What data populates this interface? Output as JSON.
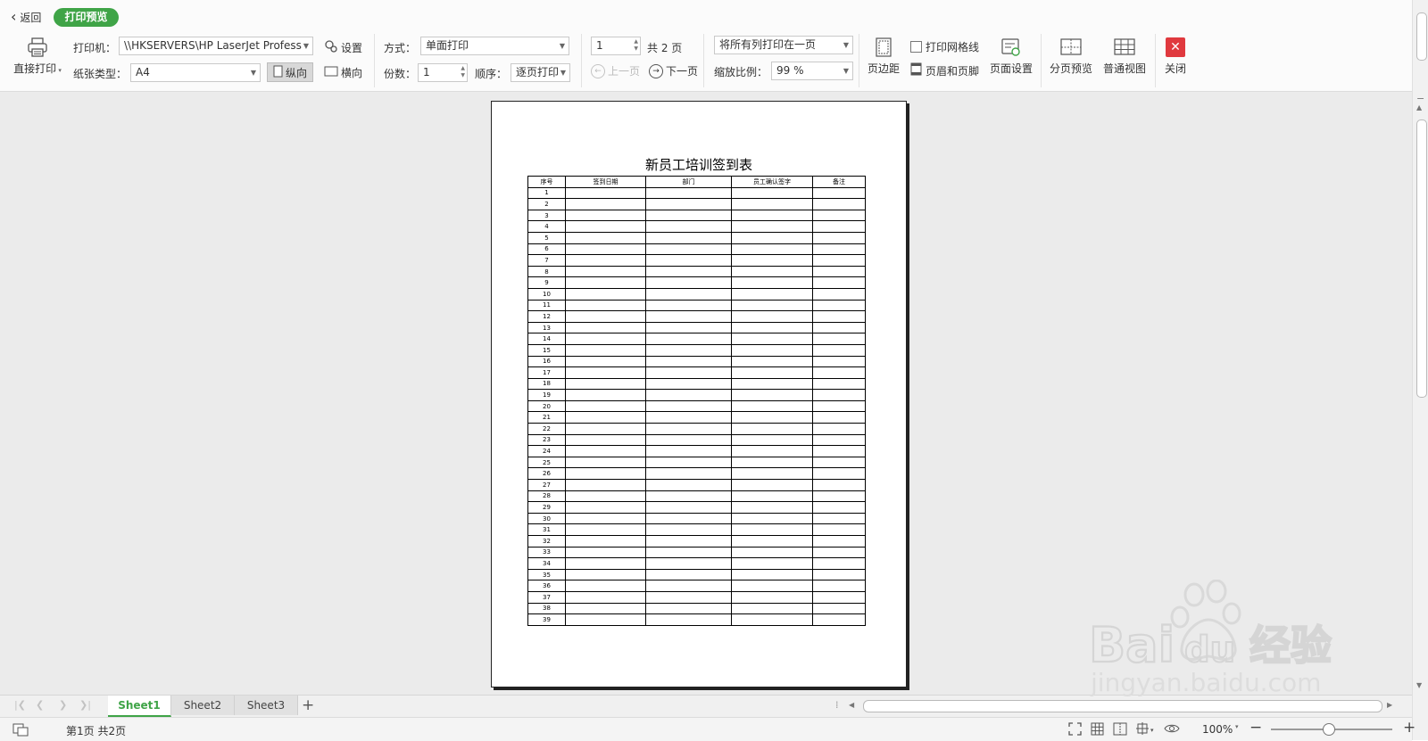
{
  "toolbar": {
    "back_label": "返回",
    "mode_badge": "打印预览",
    "direct_print_label": "直接打印",
    "printer_label": "打印机：",
    "printer_value": "\\\\HKSERVERS\\HP LaserJet Profess",
    "settings_label": "设置",
    "paper_type_label": "纸张类型：",
    "paper_type_value": "A4",
    "portrait_label": "纵向",
    "landscape_label": "横向",
    "method_label": "方式：",
    "method_value": "单面打印",
    "copies_label": "份数：",
    "copies_value": "1",
    "order_label": "顺序：",
    "order_value": "逐页打印",
    "page_value": "1",
    "total_pages": "共 2 页",
    "prev_page_label": "上一页",
    "next_page_label": "下一页",
    "fit_value": "将所有列打印在一页",
    "zoom_label": "缩放比例：",
    "zoom_value": "99 %",
    "margins_label": "页边距",
    "print_gridlines_label": "打印网格线",
    "header_footer_label": "页眉和页脚",
    "page_setup_label": "页面设置",
    "page_break_preview_label": "分页预览",
    "normal_view_label": "普通视图",
    "close_label": "关闭"
  },
  "sheet": {
    "title": "新员工培训签到表",
    "headers": [
      "序号",
      "签到日期",
      "部门",
      "员工确认签字",
      "备注"
    ],
    "rows": [
      "1",
      "2",
      "3",
      "4",
      "5",
      "6",
      "7",
      "8",
      "9",
      "10",
      "11",
      "12",
      "13",
      "14",
      "15",
      "16",
      "17",
      "18",
      "19",
      "20",
      "21",
      "22",
      "23",
      "24",
      "25",
      "26",
      "27",
      "28",
      "29",
      "30",
      "31",
      "32",
      "33",
      "34",
      "35",
      "36",
      "37",
      "38",
      "39"
    ]
  },
  "tabs": {
    "items": [
      {
        "label": "Sheet1",
        "active": true
      },
      {
        "label": "Sheet2",
        "active": false
      },
      {
        "label": "Sheet3",
        "active": false
      }
    ],
    "add_label": "+"
  },
  "status": {
    "page_info": "第1页 共2页",
    "zoom": "100%",
    "zoom_level_percent": 100
  },
  "watermark": {
    "brand": "Bai du 经验",
    "url": "jingyan.baidu.com"
  },
  "colors": {
    "accent_green": "#3fa447",
    "close_red": "#e0393e",
    "preview_bg": "#ebebeb"
  }
}
